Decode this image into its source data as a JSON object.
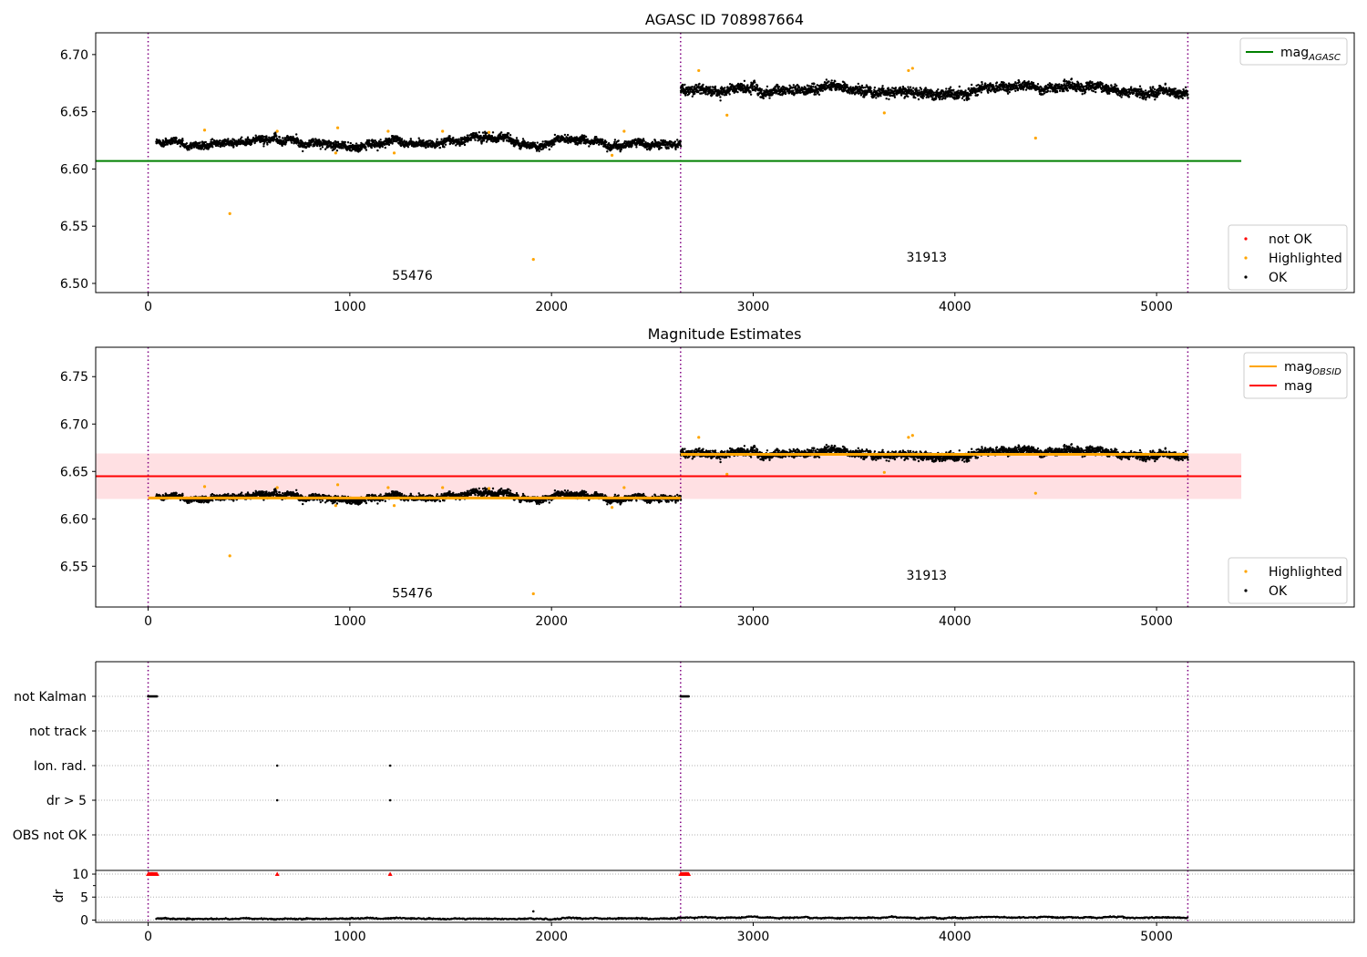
{
  "chart_data": [
    {
      "type": "scatter",
      "title": "AGASC ID 708987664",
      "xlim": [
        -260,
        5980
      ],
      "ylim": [
        6.492,
        6.719
      ],
      "x_ticks": [
        0,
        1000,
        2000,
        3000,
        4000,
        5000
      ],
      "y_ticks": [
        6.5,
        6.55,
        6.6,
        6.65,
        6.7
      ],
      "obsid_boundaries": [
        0,
        2640,
        5155
      ],
      "segments": [
        {
          "x_start": 40,
          "x_end": 2640,
          "mean": 6.623,
          "spread": 0.004,
          "label": "55476",
          "label_x": 1310,
          "label_y": 6.503
        },
        {
          "x_start": 2640,
          "x_end": 5155,
          "mean": 6.669,
          "spread": 0.005,
          "label": "31913",
          "label_x": 3860,
          "label_y": 6.519
        }
      ],
      "highlighted_points": [
        {
          "x": 280,
          "y": 6.634
        },
        {
          "x": 405,
          "y": 6.561
        },
        {
          "x": 640,
          "y": 6.633
        },
        {
          "x": 930,
          "y": 6.614
        },
        {
          "x": 940,
          "y": 6.636
        },
        {
          "x": 1190,
          "y": 6.633
        },
        {
          "x": 1220,
          "y": 6.614
        },
        {
          "x": 1460,
          "y": 6.633
        },
        {
          "x": 1690,
          "y": 6.632
        },
        {
          "x": 1910,
          "y": 6.521
        },
        {
          "x": 2300,
          "y": 6.612
        },
        {
          "x": 2360,
          "y": 6.633
        },
        {
          "x": 2730,
          "y": 6.686
        },
        {
          "x": 2870,
          "y": 6.647
        },
        {
          "x": 3650,
          "y": 6.649
        },
        {
          "x": 3770,
          "y": 6.686
        },
        {
          "x": 3790,
          "y": 6.688
        },
        {
          "x": 4400,
          "y": 6.627
        }
      ],
      "lines": [
        {
          "name": "mag_AGASC",
          "y": 6.607,
          "x_start": -260,
          "x_end": 5420,
          "color": "#008000"
        }
      ],
      "legends": [
        {
          "position": "top-right",
          "entries": [
            {
              "label": "mag",
              "subscript": "AGASC",
              "color": "#008000",
              "kind": "line"
            }
          ]
        },
        {
          "position": "lower-right",
          "entries": [
            {
              "label": "not OK",
              "color": "#ff0000",
              "kind": "dot"
            },
            {
              "label": "Highlighted",
              "color": "#ffa500",
              "kind": "dot"
            },
            {
              "label": "OK",
              "color": "#000000",
              "kind": "dot"
            }
          ]
        }
      ]
    },
    {
      "type": "scatter",
      "title": "Magnitude Estimates",
      "xlim": [
        -260,
        5980
      ],
      "ylim": [
        6.507,
        6.781
      ],
      "x_ticks": [
        0,
        1000,
        2000,
        3000,
        4000,
        5000
      ],
      "y_ticks": [
        6.55,
        6.6,
        6.65,
        6.7,
        6.75
      ],
      "obsid_boundaries": [
        0,
        2640,
        5155
      ],
      "segments": [
        {
          "x_start": 40,
          "x_end": 2640,
          "mean": 6.623,
          "spread": 0.004,
          "label": "55476",
          "label_x": 1310,
          "label_y": 6.517
        },
        {
          "x_start": 2640,
          "x_end": 5155,
          "mean": 6.669,
          "spread": 0.005,
          "label": "31913",
          "label_x": 3860,
          "label_y": 6.536
        }
      ],
      "highlighted_points": [
        {
          "x": 280,
          "y": 6.634
        },
        {
          "x": 405,
          "y": 6.561
        },
        {
          "x": 640,
          "y": 6.633
        },
        {
          "x": 930,
          "y": 6.614
        },
        {
          "x": 940,
          "y": 6.636
        },
        {
          "x": 1190,
          "y": 6.633
        },
        {
          "x": 1220,
          "y": 6.614
        },
        {
          "x": 1460,
          "y": 6.633
        },
        {
          "x": 1690,
          "y": 6.632
        },
        {
          "x": 1910,
          "y": 6.521
        },
        {
          "x": 2300,
          "y": 6.612
        },
        {
          "x": 2360,
          "y": 6.633
        },
        {
          "x": 2730,
          "y": 6.686
        },
        {
          "x": 2870,
          "y": 6.647
        },
        {
          "x": 3650,
          "y": 6.649
        },
        {
          "x": 3770,
          "y": 6.686
        },
        {
          "x": 3790,
          "y": 6.688
        },
        {
          "x": 4400,
          "y": 6.627
        }
      ],
      "mag_obsid": [
        {
          "x_start": 0,
          "x_end": 2640,
          "y": 6.622
        },
        {
          "x_start": 2640,
          "x_end": 5155,
          "y": 6.668
        }
      ],
      "mag": {
        "y": 6.645,
        "band": [
          6.621,
          6.669
        ],
        "x_start": -260,
        "x_end": 5420,
        "color": "#ff0000",
        "band_color": "#ffe0e3"
      },
      "legends": [
        {
          "position": "top-right",
          "entries": [
            {
              "label": "mag",
              "subscript": "OBSID",
              "color": "#ffa500",
              "kind": "line"
            },
            {
              "label": "mag",
              "subscript": "",
              "color": "#ff0000",
              "kind": "line"
            }
          ]
        },
        {
          "position": "lower-right",
          "entries": [
            {
              "label": "Highlighted",
              "color": "#ffa500",
              "kind": "dot"
            },
            {
              "label": "OK",
              "color": "#000000",
              "kind": "dot"
            }
          ]
        }
      ]
    },
    {
      "type": "scatter",
      "title": "",
      "xlim": [
        -260,
        5980
      ],
      "x_ticks": [
        0,
        1000,
        2000,
        3000,
        4000,
        5000
      ],
      "obsid_boundaries": [
        0,
        2640,
        5155
      ],
      "flag_rows": [
        "not Kalman",
        "not track",
        "Ion. rad.",
        "dr > 5",
        "OBS not OK"
      ],
      "flag_marks": [
        {
          "row": "not Kalman",
          "x_start": 0,
          "x_end": 45
        },
        {
          "row": "not Kalman",
          "x_start": 2640,
          "x_end": 2680
        },
        {
          "row": "Ion. rad.",
          "x_start": 640,
          "x_end": 640
        },
        {
          "row": "Ion. rad.",
          "x_start": 1200,
          "x_end": 1200
        },
        {
          "row": "dr > 5",
          "x_start": 640,
          "x_end": 640
        },
        {
          "row": "dr > 5",
          "x_start": 1200,
          "x_end": 1200
        }
      ]
    },
    {
      "type": "scatter",
      "title": "",
      "ylabel": "dr",
      "xlim": [
        -260,
        5980
      ],
      "ylim": [
        -0.5,
        10.8
      ],
      "x_ticks": [
        0,
        1000,
        2000,
        3000,
        4000,
        5000
      ],
      "y_ticks": [
        0,
        5,
        10
      ],
      "obsid_boundaries": [
        0,
        2640,
        5155
      ],
      "clipped_markers_at": 10,
      "clipped_markers": [
        {
          "x_start": 0,
          "x_end": 45
        },
        {
          "x_start": 640,
          "x_end": 640
        },
        {
          "x_start": 1200,
          "x_end": 1200
        },
        {
          "x_start": 2640,
          "x_end": 2680
        }
      ],
      "outlier_points": [
        {
          "x": 1910,
          "y": 1.9
        }
      ],
      "series": [
        {
          "name": "dr",
          "x_start": 40,
          "x_end": 2640,
          "mean": 0.3
        },
        {
          "name": "dr",
          "x_start": 2640,
          "x_end": 5155,
          "mean": 0.55
        }
      ],
      "color_not_ok": "#ff0000"
    }
  ]
}
